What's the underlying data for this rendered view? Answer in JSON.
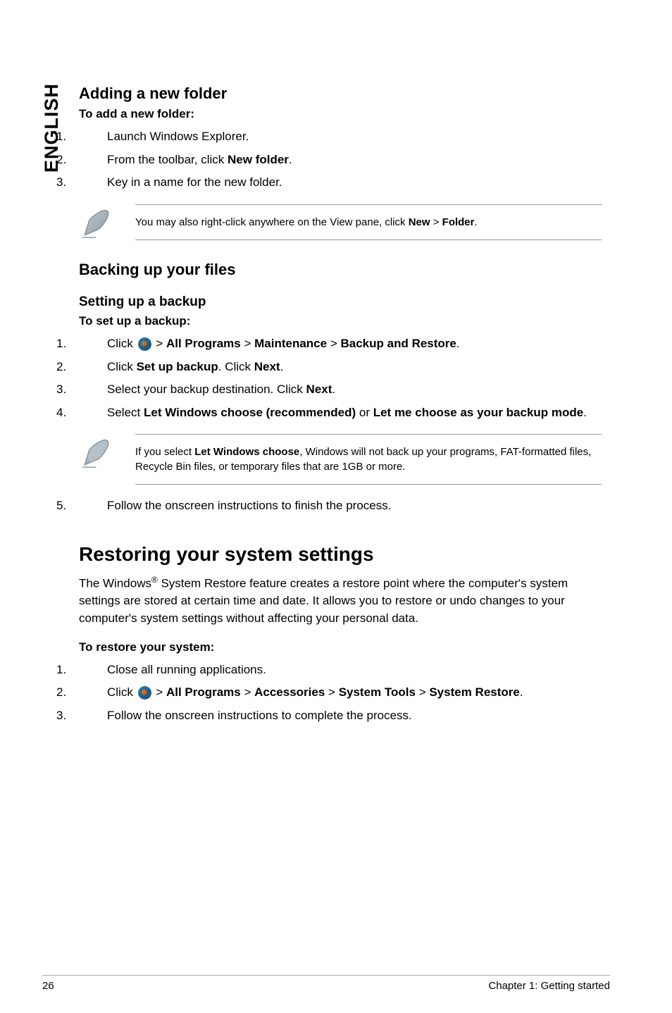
{
  "sideTab": "ENGLISH",
  "section_adding": {
    "heading": "Adding a new folder",
    "subhead": "To add a new folder:",
    "steps": [
      "Launch Windows Explorer.",
      {
        "pre": "From the toolbar, click ",
        "bold": "New folder",
        "post": "."
      },
      "Key in a name for the new folder."
    ],
    "note": {
      "pre": "You may also right-click anywhere on the View pane, click ",
      "bold1": "New",
      "mid": " > ",
      "bold2": "Folder",
      "post": "."
    }
  },
  "section_backup": {
    "heading": "Backing up your files",
    "sub2": "Setting up a backup",
    "subhead": "To set up a backup:",
    "step1": {
      "pre": "Click ",
      "post": " > ",
      "b1": "All Programs",
      "m1": " > ",
      "b2": "Maintenance",
      "m2": " > ",
      "b3": "Backup and Restore",
      "end": "."
    },
    "step2": {
      "pre": "Click ",
      "b1": "Set up backup",
      "mid": ". Click ",
      "b2": "Next",
      "post": "."
    },
    "step3": {
      "pre": "Select your backup destination. Click ",
      "b1": "Next",
      "post": "."
    },
    "step4": {
      "pre": "Select ",
      "b1": "Let Windows choose (recommended)",
      "mid": " or ",
      "b2": "Let me choose as your backup mode",
      "post": "."
    },
    "note": {
      "pre": "If you select ",
      "b1": "Let Windows choose",
      "post": ", Windows will not back up your programs, FAT-formatted files, Recycle Bin files, or temporary files that are 1GB or more."
    },
    "step5": "Follow the onscreen instructions to finish the process."
  },
  "section_restore": {
    "heading": "Restoring your system settings",
    "body": {
      "pre": "The Windows",
      "sup": "®",
      "post": " System Restore feature creates a restore point where the computer's system settings are stored at certain time and date. It allows you to restore or undo changes to your computer's system settings without affecting your personal data."
    },
    "subhead": "To restore your system:",
    "step1": "Close all running applications.",
    "step2": {
      "pre": "Click ",
      "post": " > ",
      "b1": "All Programs",
      "m1": " > ",
      "b2": "Accessories",
      "m2": " > ",
      "b3": "System Tools",
      "m3": " > ",
      "b4": "System Restore",
      "end": "."
    },
    "step3": "Follow the onscreen instructions to complete the process."
  },
  "footer": {
    "page": "26",
    "chapter": "Chapter 1: Getting started"
  }
}
